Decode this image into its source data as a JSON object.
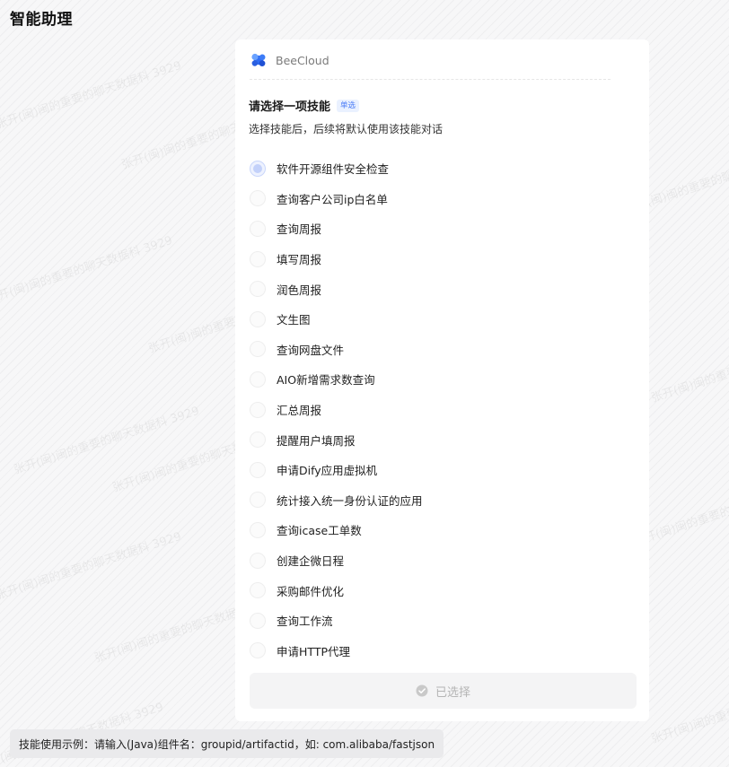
{
  "app": {
    "title": "智能助理"
  },
  "watermark": {
    "text": "张开(闽)闽的重要的聊天数据科 3929"
  },
  "card": {
    "brand_name": "BeeCloud",
    "brand_icon": "beecloud-logo-icon",
    "question_title": "请选择一项技能",
    "badge": "单选",
    "question_subtitle": "选择技能后，后续将默认使用该技能对话",
    "selected_index": 0,
    "options": [
      "软件开源组件安全检查",
      "查询客户公司ip白名单",
      "查询周报",
      "填写周报",
      "润色周报",
      "文生图",
      "查询网盘文件",
      "AIO新增需求数查询",
      "汇总周报",
      "提醒用户填周报",
      "申请Dify应用虚拟机",
      "统计接入统一身份认证的应用",
      "查询icase工单数",
      "创建企微日程",
      "采购邮件优化",
      "查询工作流",
      "申请HTTP代理"
    ],
    "confirm_label": "已选择",
    "confirm_icon": "check-circle-icon"
  },
  "hint": {
    "text": "技能使用示例：请输入(Java)组件名：groupid/artifactid，如: com.alibaba/fastjson"
  },
  "colors": {
    "accent": "#4a7cf6",
    "radio_selected": "#c3d1fa",
    "disabled_text": "#b5b5b5"
  }
}
